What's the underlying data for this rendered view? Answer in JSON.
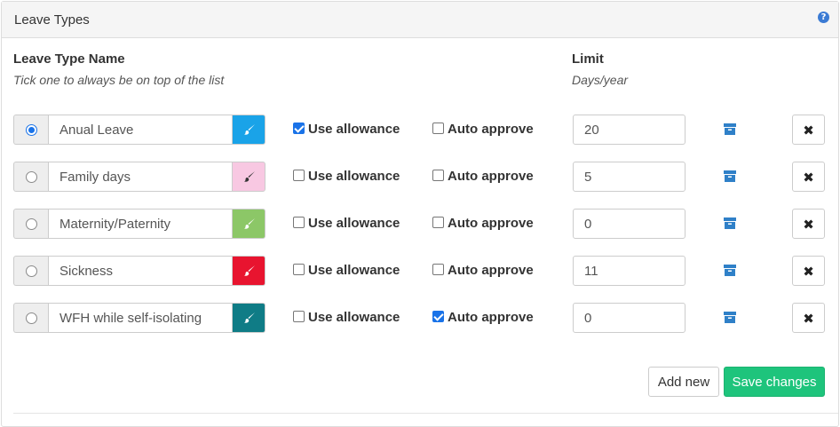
{
  "panel": {
    "title": "Leave Types",
    "help_icon": "question-circle-icon"
  },
  "columns": {
    "name_header": "Leave Type Name",
    "name_hint": "Tick one to always be on top of the list",
    "limit_header": "Limit",
    "limit_hint": "Days/year"
  },
  "labels": {
    "use_allowance": "Use allowance",
    "auto_approve": "Auto approve",
    "remove_icon": "times-icon",
    "archive_icon": "archive-box-icon",
    "color_icon": "paint-brush-icon"
  },
  "leave_types": [
    {
      "name": "Anual Leave",
      "color": "#1aa3e8",
      "brush_color": "#ffffff",
      "primary": true,
      "use_allowance": true,
      "auto_approve": false,
      "limit": "20"
    },
    {
      "name": "Family days",
      "color": "#f8c8e2",
      "brush_color": "#333333",
      "primary": false,
      "use_allowance": false,
      "auto_approve": false,
      "limit": "5"
    },
    {
      "name": "Maternity/Paternity",
      "color": "#8cc767",
      "brush_color": "#ffffff",
      "primary": false,
      "use_allowance": false,
      "auto_approve": false,
      "limit": "0"
    },
    {
      "name": "Sickness",
      "color": "#e8142f",
      "brush_color": "#ffffff",
      "primary": false,
      "use_allowance": false,
      "auto_approve": false,
      "limit": "11"
    },
    {
      "name": "WFH while self-isolating",
      "color": "#0f7c86",
      "brush_color": "#ffffff",
      "primary": false,
      "use_allowance": false,
      "auto_approve": true,
      "limit": "0"
    }
  ],
  "actions": {
    "add_new": "Add new",
    "save_changes": "Save changes"
  },
  "colors": {
    "accent_blue": "#1a73e8",
    "archive_icon": "#2f80c8",
    "save_green": "#1ec47c"
  }
}
